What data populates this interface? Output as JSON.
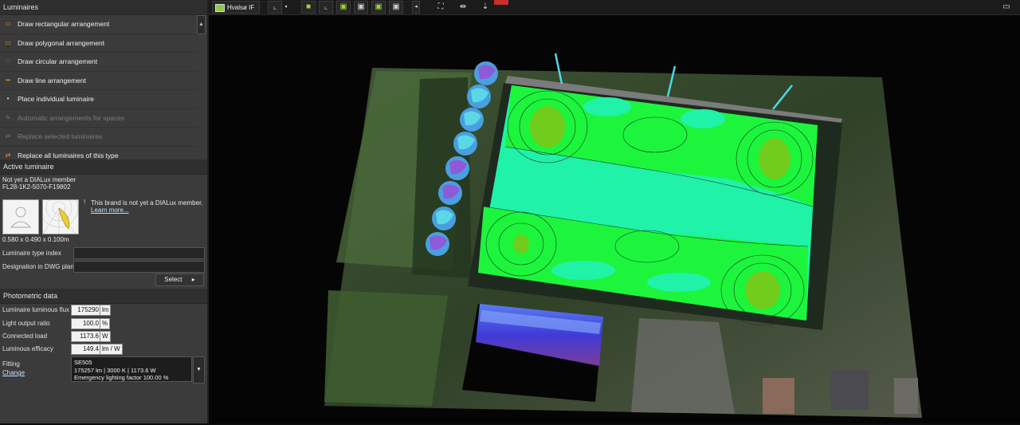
{
  "luminaires_panel": {
    "title": "Luminaires",
    "items": [
      {
        "label": "Draw rectangular arrangement",
        "icon": "rect-arrangement-icon",
        "enabled": true
      },
      {
        "label": "Draw polygonal arrangement",
        "icon": "polygon-arrangement-icon",
        "enabled": true
      },
      {
        "label": "Draw circular arrangement",
        "icon": "circle-arrangement-icon",
        "enabled": true
      },
      {
        "label": "Draw line arrangement",
        "icon": "line-arrangement-icon",
        "enabled": true
      },
      {
        "label": "Place individual luminaire",
        "icon": "single-luminaire-icon",
        "enabled": true
      },
      {
        "label": "Automatic arrangements for spaces",
        "icon": "auto-arrangement-icon",
        "enabled": false
      },
      {
        "label": "Replace selected luminaires",
        "icon": "replace-selected-icon",
        "enabled": false
      },
      {
        "label": "Replace all luminaires of this type",
        "icon": "replace-all-icon",
        "enabled": true
      }
    ]
  },
  "active_luminaire": {
    "title": "Active luminaire",
    "manufacturer": "Not yet a DIALux member",
    "model": "FL28-1K2-5070-F19802",
    "notice": "This brand is not yet a DIALux member.",
    "learn_more": "Learn more...",
    "dimensions": "0.580 x 0.490 x 0.100m",
    "type_index_label": "Luminaire type index",
    "type_index_value": "",
    "dwg_label": "Designation in DWG plan",
    "dwg_value": "",
    "select_label": "Select"
  },
  "photometric": {
    "title": "Photometric data",
    "rows": [
      {
        "label": "Luminaire luminous flux",
        "value": "175290",
        "unit": "lm"
      },
      {
        "label": "Light output ratio",
        "value": "100.0",
        "unit": "%"
      },
      {
        "label": "Connected load",
        "value": "1173.6",
        "unit": "W"
      },
      {
        "label": "Luminous efficacy",
        "value": "149.4",
        "unit": "lm / W"
      }
    ],
    "fitting_label": "Fitting",
    "change_label": "Change",
    "fitting_name": "SE505",
    "fitting_specs": "175257 lm  |  3000 K  |  1173.6 W",
    "fitting_emergency": "Emergency lighting factor 100.00 %"
  },
  "toolbar": {
    "view_label": "Hvalsø IF"
  },
  "colors": {
    "panel_bg": "#3b3b3b",
    "accent_green": "#1cf53c",
    "field_cyan": "#20f2a8",
    "accent_orange": "#e8a23a"
  }
}
